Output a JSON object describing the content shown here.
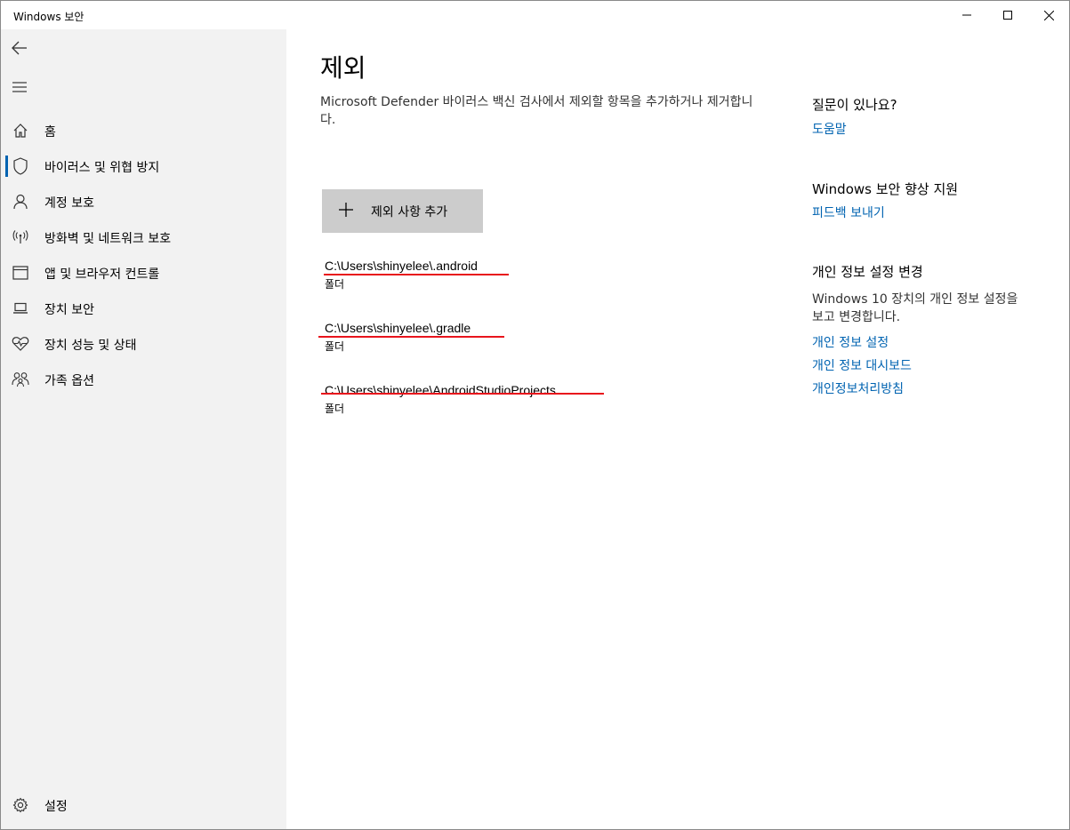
{
  "window": {
    "title": "Windows 보안"
  },
  "sidebar": {
    "items": [
      {
        "label": "홈",
        "icon": "home-icon"
      },
      {
        "label": "바이러스 및 위협 방지",
        "icon": "shield-icon",
        "active": true
      },
      {
        "label": "계정 보호",
        "icon": "person-icon"
      },
      {
        "label": "방화벽 및 네트워크 보호",
        "icon": "network-icon"
      },
      {
        "label": "앱 및 브라우저 컨트롤",
        "icon": "browser-window-icon"
      },
      {
        "label": "장치 보안",
        "icon": "laptop-icon"
      },
      {
        "label": "장치 성능 및 상태",
        "icon": "heart-pulse-icon"
      },
      {
        "label": "가족 옵션",
        "icon": "family-icon"
      }
    ],
    "settings_label": "설정"
  },
  "main": {
    "title": "제외",
    "description": "Microsoft Defender 바이러스 백신 검사에서 제외할 항목을 추가하거나 제거합니다.",
    "add_button_label": "제외 사항 추가",
    "exclusions": [
      {
        "path": "C:\\Users\\shinyelee\\.android",
        "type": "폴더"
      },
      {
        "path": "C:\\Users\\shinyelee\\.gradle",
        "type": "폴더"
      },
      {
        "path": "C:\\Users\\shinyelee\\AndroidStudioProjects",
        "type": "폴더"
      }
    ]
  },
  "right_panel": {
    "question_heading": "질문이 있나요?",
    "help_link": "도움말",
    "improve_heading": "Windows 보안 향상 지원",
    "feedback_link": "피드백 보내기",
    "privacy_heading": "개인 정보 설정 변경",
    "privacy_text": "Windows 10 장치의 개인 정보 설정을 보고 변경합니다.",
    "privacy_settings_link": "개인 정보 설정",
    "privacy_dashboard_link": "개인 정보 대시보드",
    "privacy_statement_link": "개인정보처리방침"
  },
  "colors": {
    "accent": "#0063b1",
    "sidebar_bg": "#f2f2f2",
    "button_bg": "#cccccc",
    "annotation_red": "#e8141c"
  }
}
